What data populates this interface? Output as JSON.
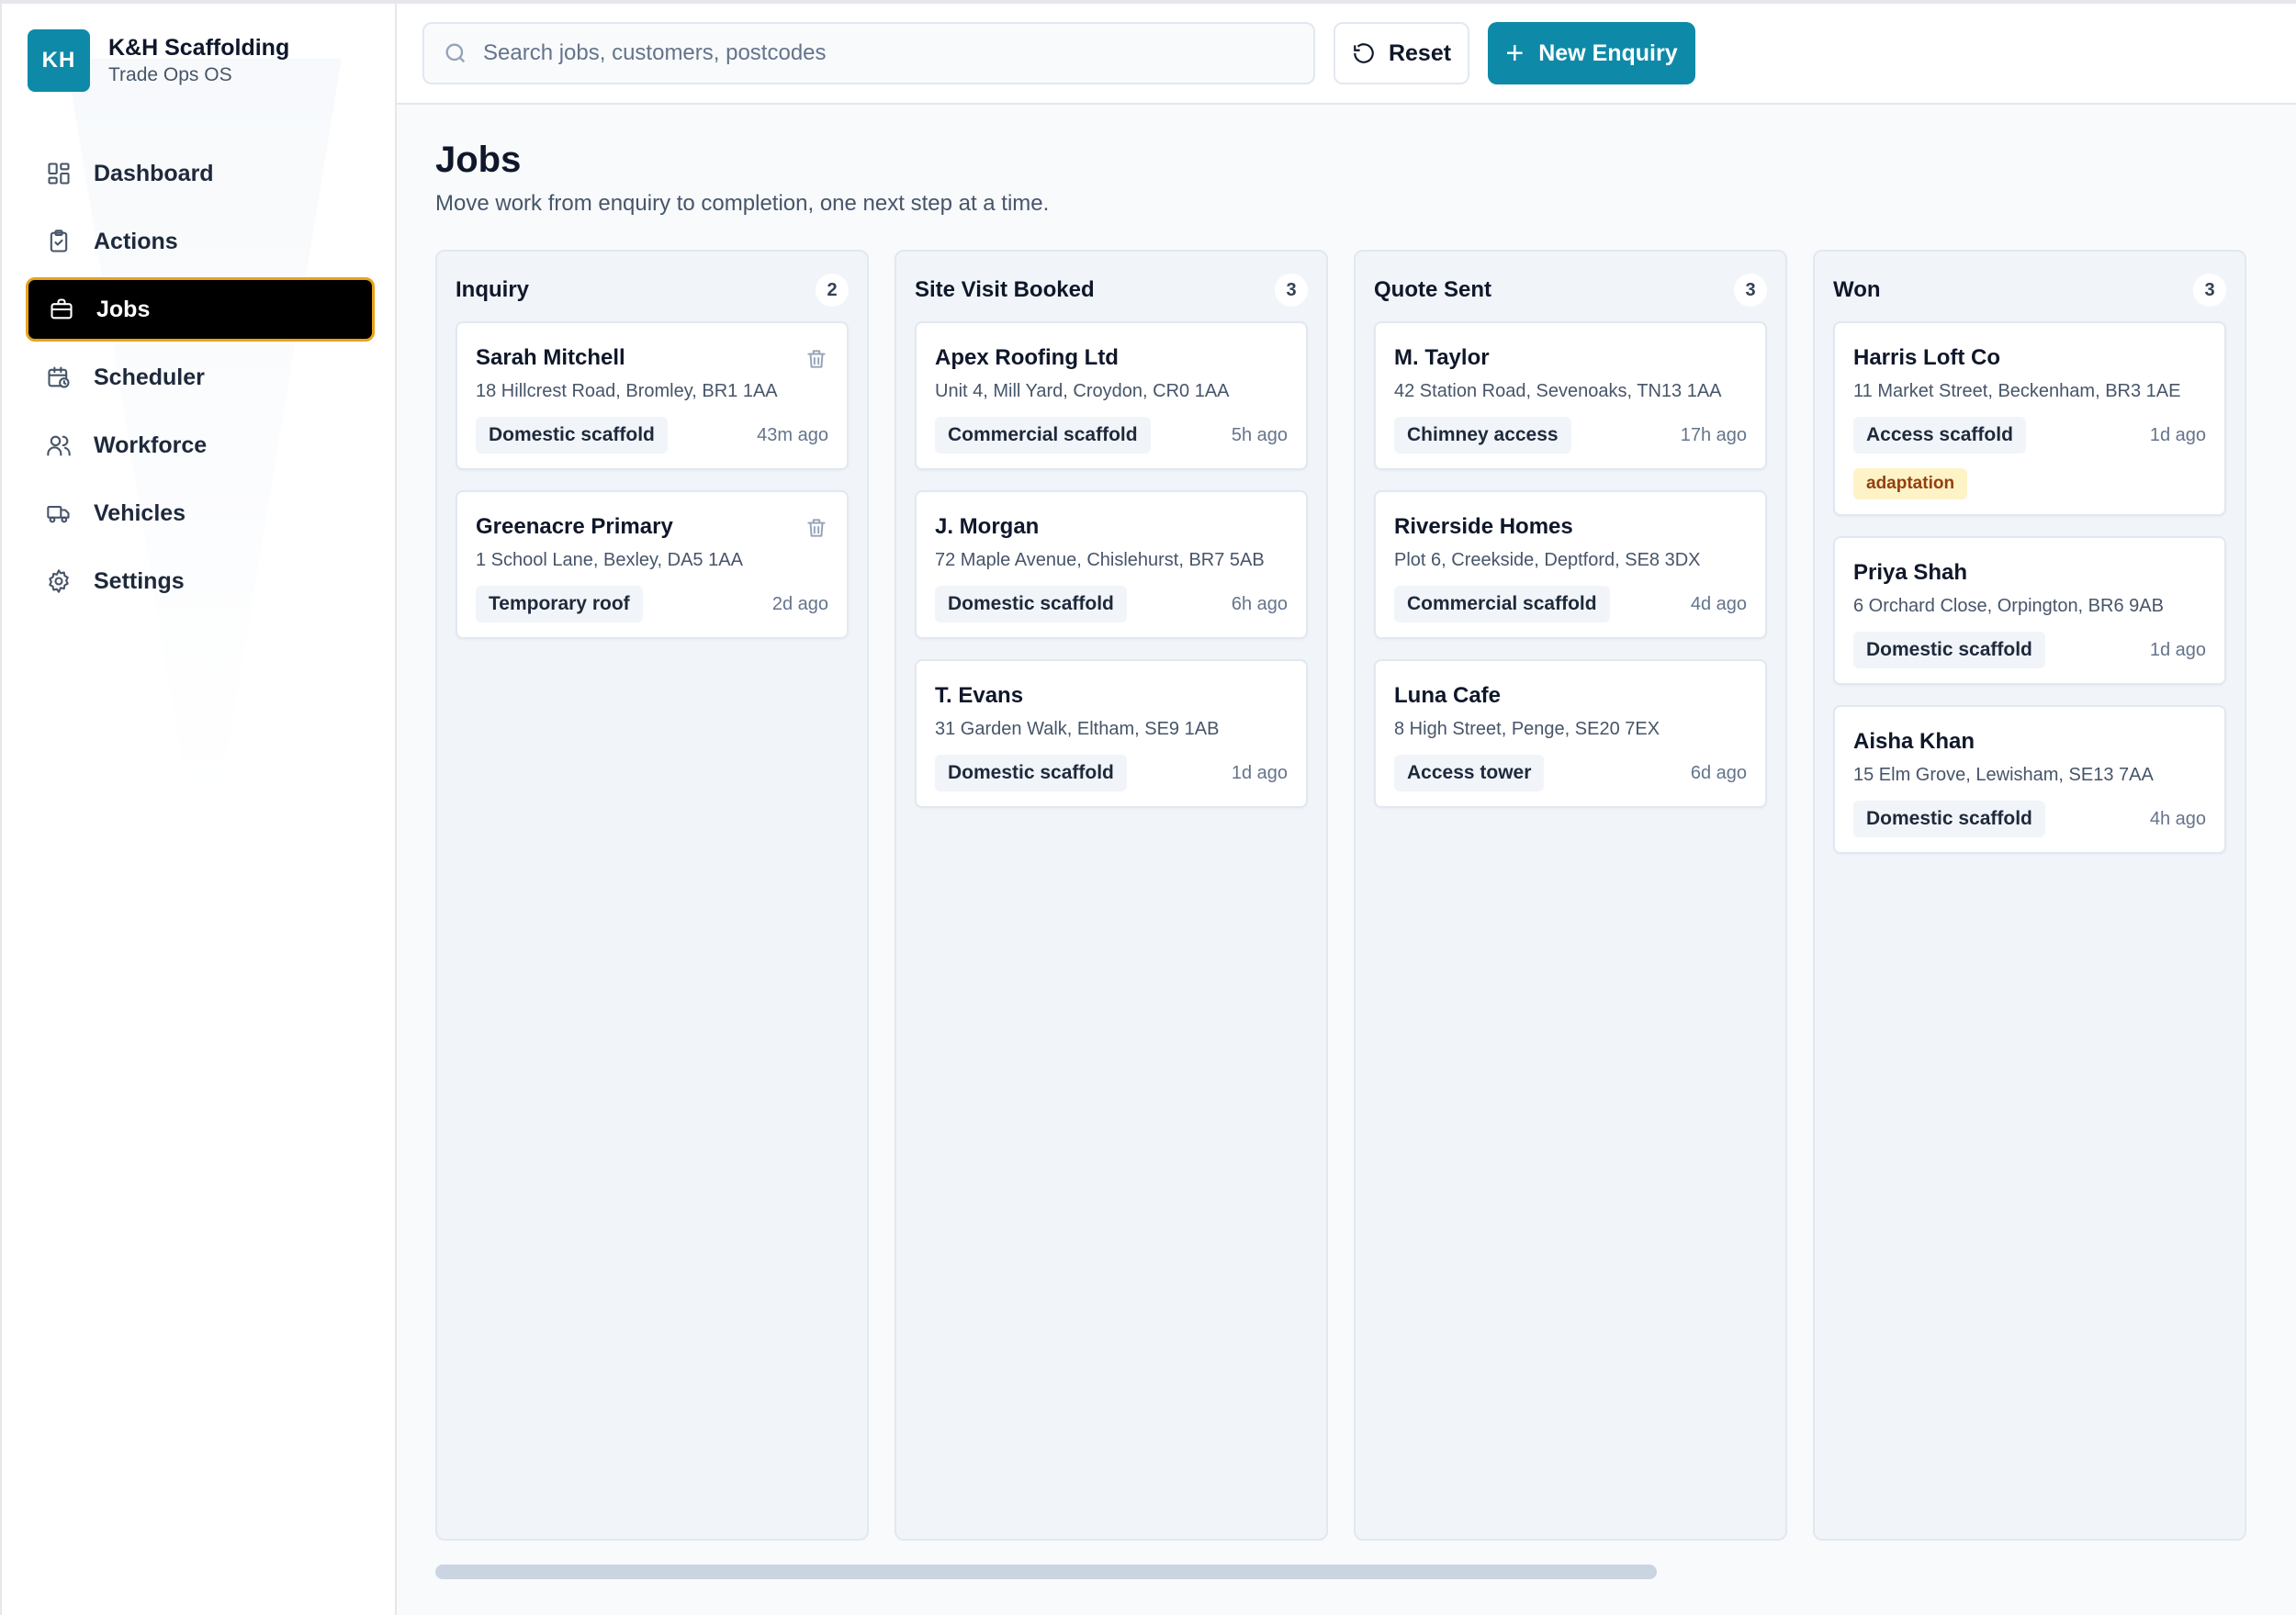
{
  "brand": {
    "initials": "KH",
    "name": "K&H Scaffolding",
    "subtitle": "Trade Ops OS",
    "color": "#0e8aa8"
  },
  "nav": [
    {
      "label": "Dashboard",
      "icon": "dashboard-icon",
      "active": false
    },
    {
      "label": "Actions",
      "icon": "clipboard-icon",
      "active": false
    },
    {
      "label": "Jobs",
      "icon": "briefcase-icon",
      "active": true
    },
    {
      "label": "Scheduler",
      "icon": "calendar-clock-icon",
      "active": false
    },
    {
      "label": "Workforce",
      "icon": "users-icon",
      "active": false
    },
    {
      "label": "Vehicles",
      "icon": "truck-icon",
      "active": false
    },
    {
      "label": "Settings",
      "icon": "gear-icon",
      "active": false
    }
  ],
  "topbar": {
    "search_placeholder": "Search jobs, customers, postcodes",
    "reset_label": "Reset",
    "new_label": "New Enquiry"
  },
  "page": {
    "title": "Jobs",
    "subtitle": "Move work from enquiry to completion, one next step at a time."
  },
  "columns": [
    {
      "title": "Inquiry",
      "count": "2",
      "cards": [
        {
          "name": "Sarah Mitchell",
          "address": "18 Hillcrest Road, Bromley, BR1 1AA",
          "type": "Domestic scaffold",
          "age": "43m ago",
          "deletable": true
        },
        {
          "name": "Greenacre Primary",
          "address": "1 School Lane, Bexley, DA5 1AA",
          "type": "Temporary roof",
          "age": "2d ago",
          "deletable": true
        }
      ]
    },
    {
      "title": "Site Visit Booked",
      "count": "3",
      "cards": [
        {
          "name": "Apex Roofing Ltd",
          "address": "Unit 4, Mill Yard, Croydon, CR0 1AA",
          "type": "Commercial scaffold",
          "age": "5h ago"
        },
        {
          "name": "J. Morgan",
          "address": "72 Maple Avenue, Chislehurst, BR7 5AB",
          "type": "Domestic scaffold",
          "age": "6h ago"
        },
        {
          "name": "T. Evans",
          "address": "31 Garden Walk, Eltham, SE9 1AB",
          "type": "Domestic scaffold",
          "age": "1d ago"
        }
      ]
    },
    {
      "title": "Quote Sent",
      "count": "3",
      "cards": [
        {
          "name": "M. Taylor",
          "address": "42 Station Road, Sevenoaks, TN13 1AA",
          "type": "Chimney access",
          "age": "17h ago"
        },
        {
          "name": "Riverside Homes",
          "address": "Plot 6, Creekside, Deptford, SE8 3DX",
          "type": "Commercial scaffold",
          "age": "4d ago"
        },
        {
          "name": "Luna Cafe",
          "address": "8 High Street, Penge, SE20 7EX",
          "type": "Access tower",
          "age": "6d ago"
        }
      ]
    },
    {
      "title": "Won",
      "count": "3",
      "cards": [
        {
          "name": "Harris Loft Co",
          "address": "11 Market Street, Beckenham, BR3 1AE",
          "type": "Access scaffold",
          "age": "1d ago",
          "tag": "adaptation"
        },
        {
          "name": "Priya Shah",
          "address": "6 Orchard Close, Orpington, BR6 9AB",
          "type": "Domestic scaffold",
          "age": "1d ago"
        },
        {
          "name": "Aisha Khan",
          "address": "15 Elm Grove, Lewisham, SE13 7AA",
          "type": "Domestic scaffold",
          "age": "4h ago"
        }
      ]
    }
  ],
  "colors": {
    "accent": "#0e8aa8",
    "active_outline": "#e8a21a",
    "tag_bg": "#fef3c7",
    "tag_text": "#92400e"
  }
}
